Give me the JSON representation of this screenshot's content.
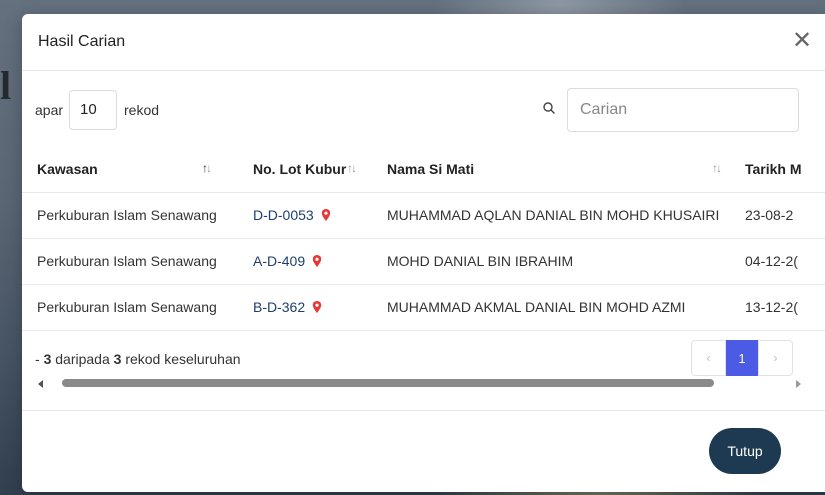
{
  "modal": {
    "title": "Hasil Carian",
    "close_symbol": "✕"
  },
  "controls": {
    "length_prefix": "apar",
    "length_value": "10",
    "length_suffix": "rekod",
    "search_placeholder": "Carian"
  },
  "table": {
    "headers": [
      "Kawasan",
      "No. Lot Kubur",
      "Nama Si Mati",
      "Tarikh M"
    ],
    "rows": [
      [
        "Perkuburan Islam Senawang",
        "D-D-0053",
        "MUHAMMAD AQLAN DANIAL BIN MOHD KHUSAIRI",
        "23-08-2"
      ],
      [
        "Perkuburan Islam Senawang",
        "A-D-409",
        "MOHD DANIAL BIN IBRAHIM",
        "04-12-2("
      ],
      [
        "Perkuburan Islam Senawang",
        "B-D-362",
        "MUHAMMAD AKMAL DANIAL BIN MOHD AZMI",
        "13-12-2("
      ]
    ]
  },
  "info": {
    "prefix": "- ",
    "shown": "3",
    "middle": " daripada ",
    "total": "3",
    "suffix": " rekod keseluruhan"
  },
  "pagination": {
    "prev": "‹",
    "current": "1",
    "next": "›"
  },
  "footer": {
    "close_label": "Tutup"
  },
  "colors": {
    "accent": "#4b5be6",
    "primary_button": "#1e3a52",
    "pin": "#e53935"
  },
  "icons": [
    "close-icon",
    "search-icon",
    "location-pin-icon",
    "sort-icon"
  ]
}
